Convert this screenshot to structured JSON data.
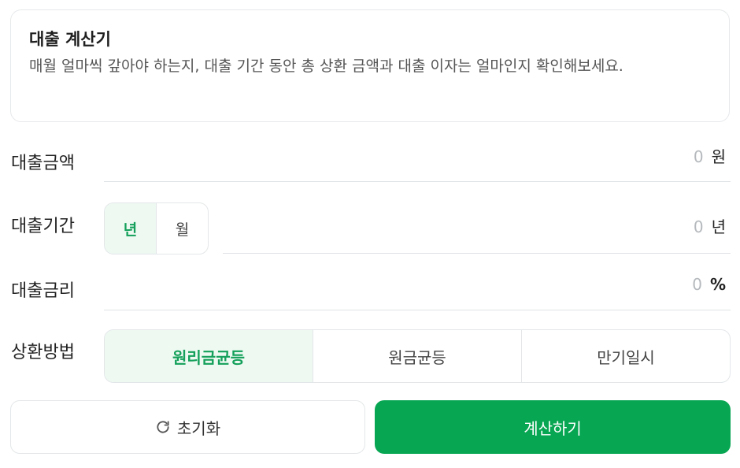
{
  "info": {
    "title": "대출 계산기",
    "description": "매월 얼마씩 갚아야 하는지, 대출 기간 동안 총 상환 금액과 대출 이자는 얼마인지 확인해보세요."
  },
  "fields": {
    "amount": {
      "label": "대출금액",
      "value": "0",
      "unit": "원"
    },
    "period": {
      "label": "대출기간",
      "value": "0",
      "unit": "년",
      "options": [
        "년",
        "월"
      ],
      "selected": "년"
    },
    "rate": {
      "label": "대출금리",
      "value": "0",
      "unit": "%"
    }
  },
  "repayment": {
    "label": "상환방법",
    "options": [
      "원리금균등",
      "원금균등",
      "만기일시"
    ],
    "selected": "원리금균등"
  },
  "buttons": {
    "reset_label": "초기화",
    "reset_icon": "refresh-icon",
    "calc_label": "계산하기"
  },
  "colors": {
    "accent": "#07a652",
    "accent_text": "#14a05a",
    "active_bg": "#eef9f2"
  }
}
